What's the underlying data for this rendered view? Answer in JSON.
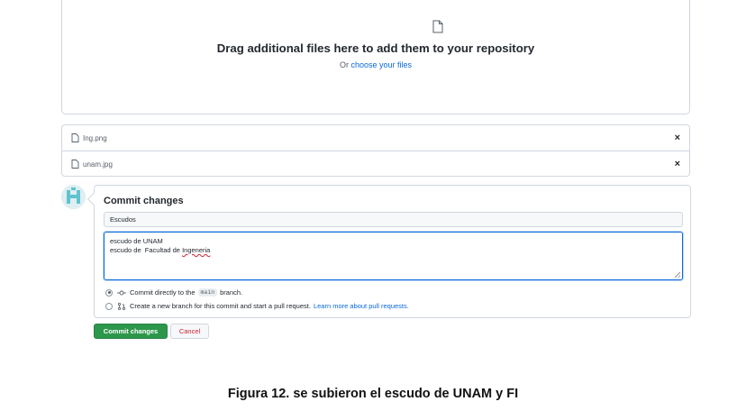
{
  "dropzone": {
    "icon": "file-icon",
    "title": "Drag additional files here to add them to your repository",
    "prefix": "Or",
    "choose_link": "choose your files"
  },
  "files": [
    {
      "name": "Ing.png",
      "icon": "file-icon",
      "remove": "×"
    },
    {
      "name": "unam.jpg",
      "icon": "file-icon",
      "remove": "×"
    }
  ],
  "commit": {
    "title": "Commit changes",
    "summary_value": "Escudos",
    "description_line1": "escudo de UNAM",
    "description_line2_prefix": "escudo de  Facultad de ",
    "description_line2_misspelled": "Ingeneria",
    "option_direct": {
      "text_before": "Commit directly to the",
      "branch": "main",
      "text_after": "branch.",
      "checked": true
    },
    "option_new_branch": {
      "text": "Create a new branch for this commit and start a pull request.",
      "link": "Learn more about pull requests.",
      "checked": false
    },
    "submit_label": "Commit changes",
    "cancel_label": "Cancel"
  },
  "colors": {
    "accent": "#0969da",
    "primary_button": "#2c974b",
    "cancel_text": "#cf222e",
    "border": "#d0d7de"
  },
  "caption": "Figura 12. se subieron el escudo de UNAM y FI"
}
